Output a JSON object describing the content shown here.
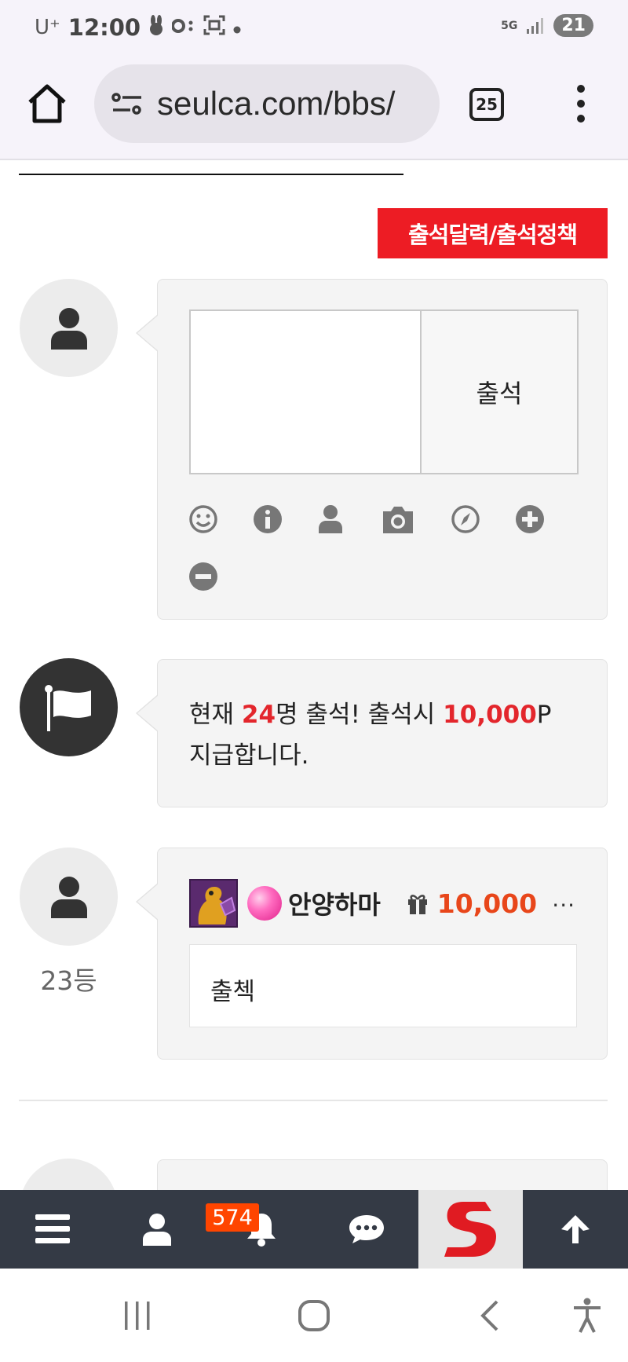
{
  "status_bar": {
    "carrier": "U⁺",
    "time": "12:00",
    "network": "5G",
    "battery": "21"
  },
  "browser": {
    "url": "seulca.com/bbs/",
    "tab_count": "25"
  },
  "page": {
    "policy_button": "출석달력/출석정책",
    "checkin_button": "출석",
    "notice": {
      "prefix": "현재 ",
      "count": "24",
      "middle": "명 출석! 출석시 ",
      "points": "10,000",
      "suffix": "P 지급합니다."
    },
    "entry": {
      "username": "안양하마",
      "points": "10,000",
      "more": "...",
      "comment": "출첵",
      "rank": "23등"
    }
  },
  "bottom_nav": {
    "notification_count": "574"
  },
  "colors": {
    "accent_red": "#ed1c24",
    "points_orange": "#e8461a",
    "nav_bg": "#343a45"
  }
}
